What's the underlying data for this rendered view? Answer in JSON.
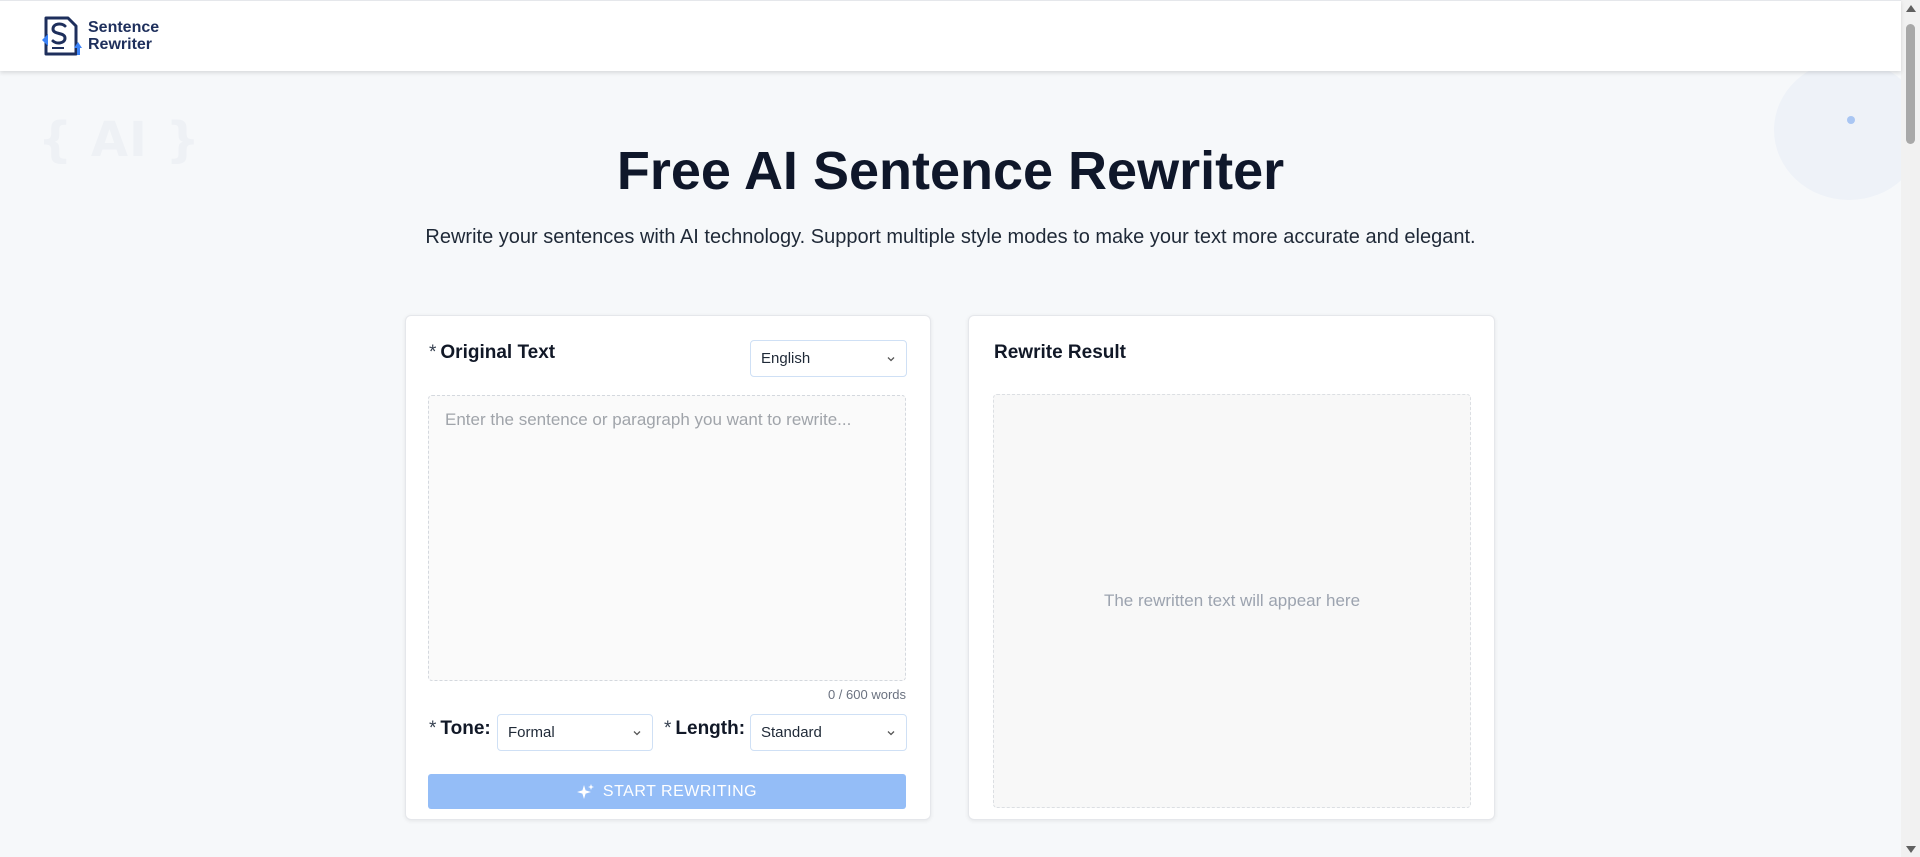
{
  "brand": {
    "name_line1": "Sentence",
    "name_line2": "Rewriter",
    "color": "#1e2f5c"
  },
  "decor": {
    "ai_badge": "{ AI }"
  },
  "hero": {
    "title": "Free AI Sentence Rewriter",
    "subtitle": "Rewrite your sentences with AI technology. Support multiple style modes to make your text more accurate and elegant."
  },
  "input_panel": {
    "required_mark": "*",
    "title": "Original Text",
    "language_select": "English",
    "textarea_placeholder": "Enter the sentence or paragraph you want to rewrite...",
    "word_count": "0 / 600 words",
    "tone_label": "Tone:",
    "tone_value": "Formal",
    "length_label": "Length:",
    "length_value": "Standard",
    "start_button": "START REWRITING"
  },
  "result_panel": {
    "title": "Rewrite Result",
    "placeholder": "The rewritten text will appear here"
  },
  "colors": {
    "accent": "#94bdf7",
    "title": "#0f172a",
    "background": "#f6f8fa"
  },
  "icons": {
    "logo": "document-s-logo-icon",
    "chevron": "chevron-down-icon",
    "start": "sparkle-icon"
  }
}
